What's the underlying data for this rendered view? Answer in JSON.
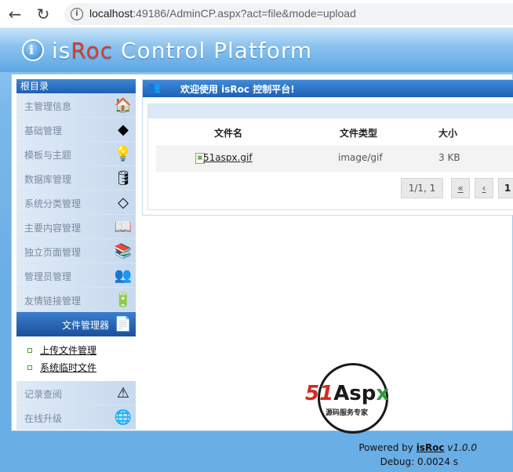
{
  "browser": {
    "url_host": "localhost",
    "url_rest": ":49186/AdminCP.aspx?act=file&mode=upload"
  },
  "banner": {
    "brand_is": "is",
    "brand_r": "Roc",
    "brand_rest": " Control Platform"
  },
  "sidebar": {
    "title": "根目录",
    "items": [
      {
        "label": "主管理信息",
        "icon": "house-icon"
      },
      {
        "label": "基础管理",
        "icon": "cube-icon"
      },
      {
        "label": "模板与主题",
        "icon": "lightbulb-icon"
      },
      {
        "label": "数据库管理",
        "icon": "database-icon"
      },
      {
        "label": "系统分类管理",
        "icon": "tag-icon"
      },
      {
        "label": "主要内容管理",
        "icon": "book-icon"
      },
      {
        "label": "独立页面管理",
        "icon": "books-icon"
      },
      {
        "label": "管理员管理",
        "icon": "users-icon"
      },
      {
        "label": "友情链接管理",
        "icon": "battery-icon"
      },
      {
        "label": "文件管理器",
        "icon": "file-icon"
      }
    ],
    "submenu": [
      "上传文件管理",
      "系统临时文件"
    ],
    "bottom_items": [
      {
        "label": "记录查阅",
        "icon": "warning-icon"
      },
      {
        "label": "在线升级",
        "icon": "download-globe-icon"
      }
    ]
  },
  "content": {
    "welcome": "欢迎使用 isRoc 控制平台!",
    "columns": [
      "文件名",
      "文件类型",
      "大小"
    ],
    "files": [
      {
        "name": "51aspx.gif",
        "type": "image/gif",
        "size": "3 KB"
      }
    ],
    "pager": {
      "info": "1/1, 1",
      "first": "«",
      "prev": "‹",
      "current": "1"
    }
  },
  "watermark": {
    "num": "51",
    "asp": "Asp",
    "x": "x",
    "sub": "源码服务专家"
  },
  "footer": {
    "powered_prefix": "Powered by ",
    "powered_brand": "isRoc",
    "version": " v1.0.0",
    "debug": "Debug: 0.0024 s"
  }
}
